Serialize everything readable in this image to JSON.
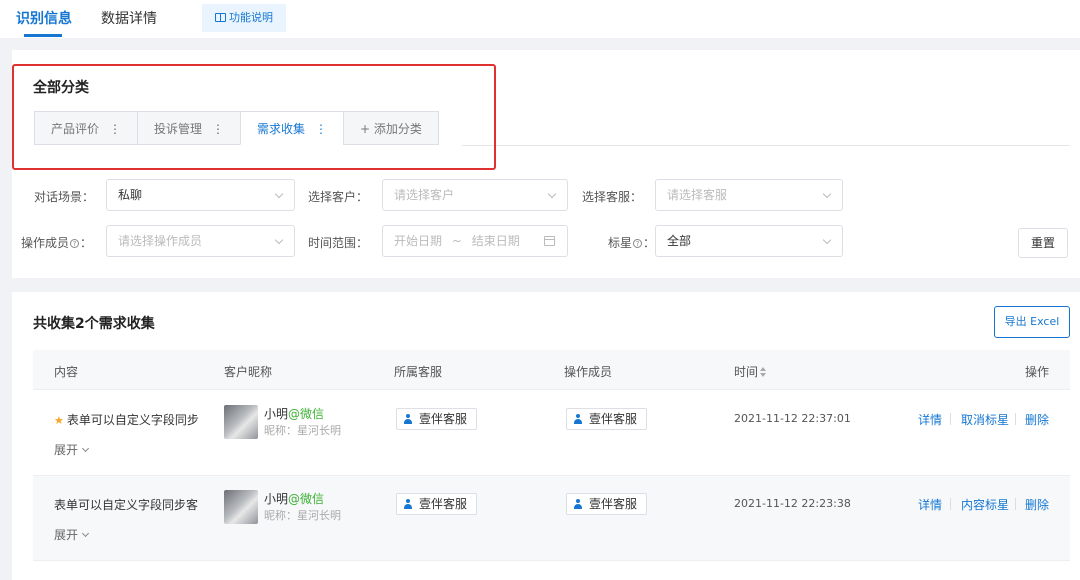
{
  "top_tabs": [
    {
      "label": "识别信息",
      "active": true
    },
    {
      "label": "数据详情",
      "active": false
    }
  ],
  "function_button": "功能说明",
  "categories": {
    "title": "全部分类",
    "tabs": [
      {
        "label": "产品评价",
        "more": "⋮"
      },
      {
        "label": "投诉管理",
        "more": "⋮"
      },
      {
        "label": "需求收集",
        "more": "⋮",
        "active": true
      }
    ],
    "add_label": "+ 添加分类"
  },
  "filters": {
    "scene_label": "对话场景：",
    "scene_value": "私聊",
    "customer_label": "选择客户：",
    "customer_placeholder": "请选择客户",
    "service_label": "选择客服：",
    "service_placeholder": "请选择客服",
    "operator_label": "操作成员",
    "operator_colon": "：",
    "operator_placeholder": "请选择操作成员",
    "range_label": "时间范围：",
    "start_placeholder": "开始日期",
    "range_sep": "~",
    "end_placeholder": "结束日期",
    "star_label": "标星",
    "star_colon": "：",
    "star_value": "全部",
    "help_glyph": "?",
    "reset": "重置"
  },
  "summary": {
    "title": "共收集2个需求收集",
    "export": "导出 Excel"
  },
  "table": {
    "headers": {
      "content": "内容",
      "customer": "客户昵称",
      "service": "所属客服",
      "operator": "操作成员",
      "time": "时间",
      "actions": "操作"
    },
    "expand_label": "展开",
    "rows": [
      {
        "starred": true,
        "content": "表单可以自定义字段同步",
        "name": "小明",
        "source": "@微信",
        "nickname": "昵称：星河长明",
        "service": "壹伴客服",
        "operator": "壹伴客服",
        "time": "2021-11-12 22:37:01",
        "actions": [
          "详情",
          "取消标星",
          "删除"
        ]
      },
      {
        "starred": false,
        "content": "表单可以自定义字段同步客",
        "name": "小明",
        "source": "@微信",
        "nickname": "昵称：星河长明",
        "service": "壹伴客服",
        "operator": "壹伴客服",
        "time": "2021-11-12 22:23:38",
        "actions": [
          "详情",
          "内容标星",
          "删除"
        ]
      }
    ]
  },
  "colors": {
    "accent": "#1677d2",
    "highlight_border": "#e03131",
    "wechat_green": "#3cb034",
    "star": "#f5a623"
  }
}
